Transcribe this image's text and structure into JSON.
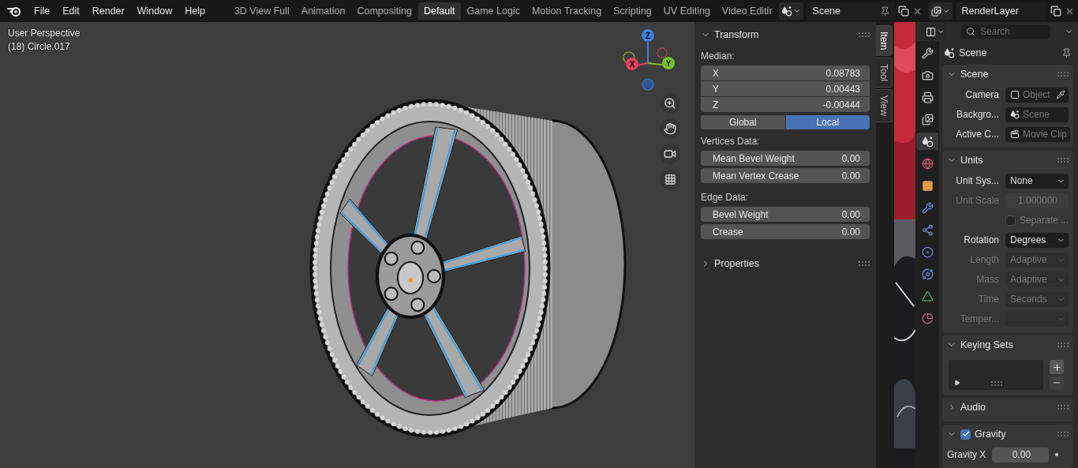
{
  "menu": [
    "File",
    "Edit",
    "Render",
    "Window",
    "Help"
  ],
  "workspaces": [
    {
      "label": "3D View Full",
      "selected": false
    },
    {
      "label": "Animation",
      "selected": false
    },
    {
      "label": "Compositing",
      "selected": false
    },
    {
      "label": "Default",
      "selected": true
    },
    {
      "label": "Game Logic",
      "selected": false
    },
    {
      "label": "Motion Tracking",
      "selected": false
    },
    {
      "label": "Scripting",
      "selected": false
    },
    {
      "label": "UV Editing",
      "selected": false
    },
    {
      "label": "Video Editir",
      "selected": false
    }
  ],
  "scene_selector": {
    "value": "Scene"
  },
  "view_layer_selector": {
    "value": "RenderLayer"
  },
  "viewport": {
    "view_name": "User Perspective",
    "object_info": "(18) Circle.017",
    "gizmo_axes": [
      "X",
      "Y",
      "Z"
    ]
  },
  "sidebar": {
    "tabs": [
      {
        "label": "Item",
        "selected": true
      },
      {
        "label": "Tool",
        "selected": false
      },
      {
        "label": "View",
        "selected": false
      }
    ],
    "transform": {
      "title": "Transform",
      "expanded": true,
      "median_label": "Median:",
      "median": [
        {
          "label": "X",
          "value": "0.08783"
        },
        {
          "label": "Y",
          "value": "0.00443"
        },
        {
          "label": "Z",
          "value": "-0.00444"
        }
      ],
      "space": [
        {
          "label": "Global",
          "selected": false
        },
        {
          "label": "Local",
          "selected": true
        }
      ],
      "vertices_label": "Vertices Data:",
      "vertices_fields": [
        {
          "label": "Mean Bevel Weight",
          "value": "0.00"
        },
        {
          "label": "Mean Vertex Crease",
          "value": "0.00"
        }
      ],
      "edge_label": "Edge Data:",
      "edge_fields": [
        {
          "label": "Bevel Weight",
          "value": "0.00"
        },
        {
          "label": "Crease",
          "value": "0.00"
        }
      ]
    },
    "properties_panel": {
      "title": "Properties",
      "expanded": false
    }
  },
  "properties": {
    "search": {
      "placeholder": "Search"
    },
    "context": "Scene",
    "tabs": [
      {
        "kind": "tool",
        "selected": false
      },
      {
        "kind": "render",
        "selected": false
      },
      {
        "kind": "output",
        "selected": false
      },
      {
        "kind": "viewlayer",
        "selected": false
      },
      {
        "kind": "scene",
        "selected": true
      },
      {
        "kind": "world",
        "selected": false
      },
      {
        "kind": "object",
        "selected": false
      },
      {
        "kind": "modifier",
        "selected": false
      },
      {
        "kind": "particles",
        "selected": false
      },
      {
        "kind": "physics",
        "selected": false
      },
      {
        "kind": "constraints",
        "selected": false
      },
      {
        "kind": "data",
        "selected": false
      },
      {
        "kind": "material",
        "selected": false
      }
    ],
    "panels": [
      {
        "kind": "form",
        "title": "Scene",
        "expanded": true,
        "rows": [
          {
            "kind": "pointer",
            "label": "Camera",
            "placeholder": "Object",
            "disabled": false
          },
          {
            "kind": "pointer",
            "label": "Backgro...",
            "placeholder": "Scene",
            "disabled": false
          },
          {
            "kind": "pointer",
            "label": "Active C...",
            "placeholder": "Movie Clip",
            "disabled": false
          }
        ]
      },
      {
        "kind": "form",
        "title": "Units",
        "expanded": true,
        "rows": [
          {
            "kind": "dropdown",
            "label": "Unit Sys...",
            "value": "None",
            "disabled": false
          },
          {
            "kind": "number",
            "label": "Unit Scale",
            "value": "1.000000",
            "disabled": true
          },
          {
            "kind": "checkbox",
            "label": "Separate ...",
            "checked": false,
            "disabled": true
          },
          {
            "kind": "dropdown",
            "label": "Rotation",
            "value": "Degrees",
            "disabled": false
          },
          {
            "kind": "dropdown",
            "label": "Length",
            "value": "Adaptive",
            "disabled": true
          },
          {
            "kind": "dropdown",
            "label": "Mass",
            "value": "Adaptive",
            "disabled": true
          },
          {
            "kind": "dropdown",
            "label": "Time",
            "value": "Seconds",
            "disabled": true
          },
          {
            "kind": "dropdown",
            "label": "Temper...",
            "disabled": true
          }
        ]
      },
      {
        "kind": "list",
        "title": "Keying Sets",
        "expanded": true
      },
      {
        "kind": "form",
        "title": "Audio",
        "expanded": false
      },
      {
        "kind": "form",
        "title": "Gravity",
        "expanded": true,
        "checked": true,
        "rows": [
          {
            "kind": "number",
            "label": "Gravity X",
            "value": "0.00",
            "disabled": false
          }
        ]
      }
    ]
  }
}
